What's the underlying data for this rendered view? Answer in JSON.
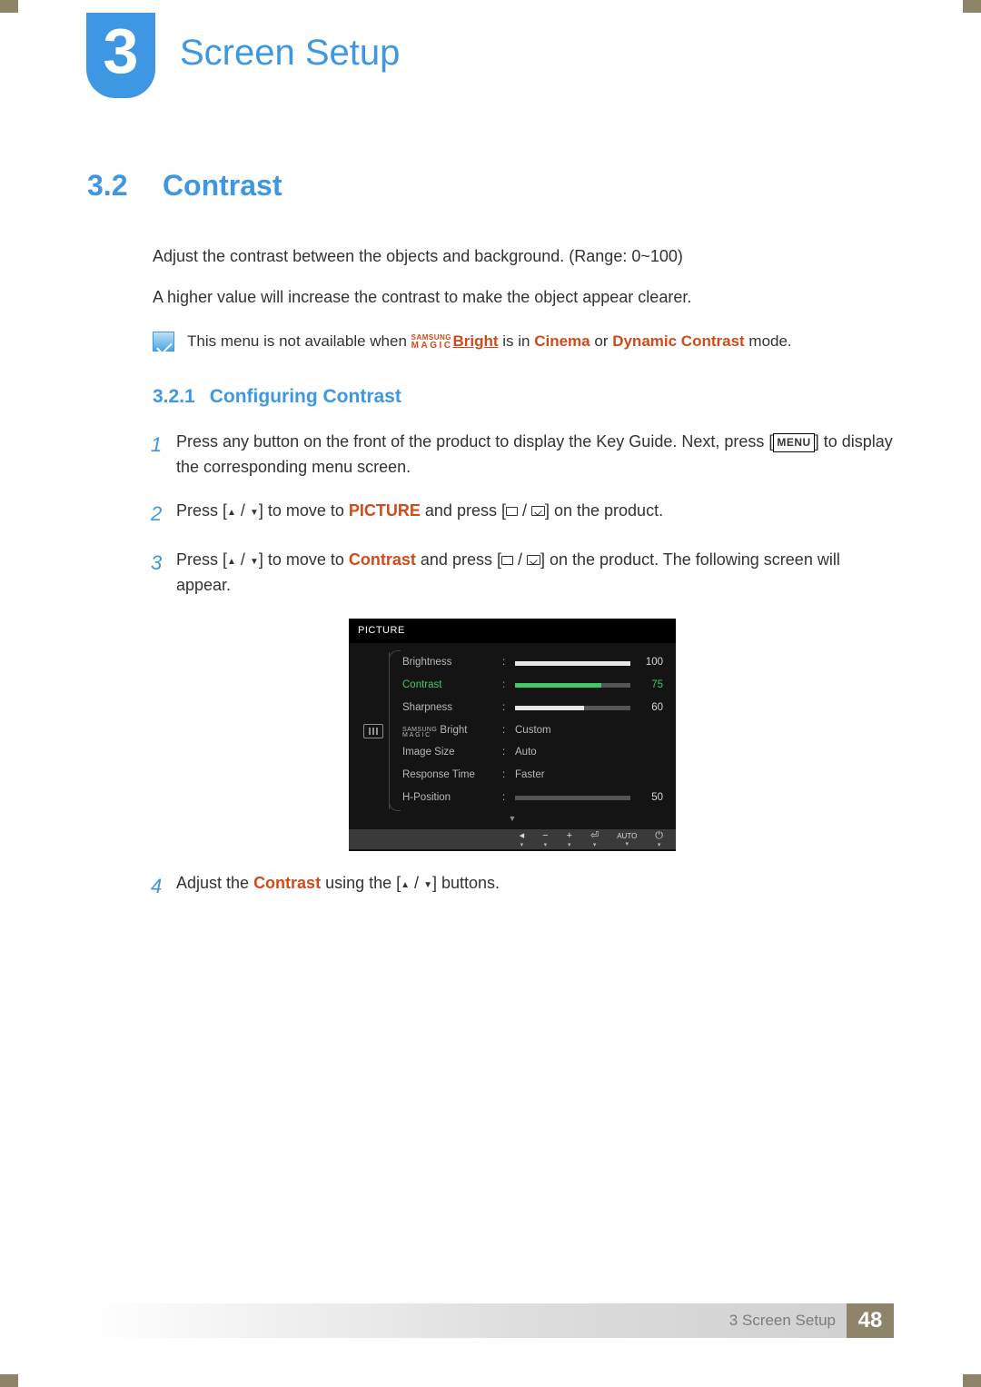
{
  "chapter": {
    "number": "3",
    "title": "Screen Setup"
  },
  "section": {
    "number": "3.2",
    "title": "Contrast"
  },
  "intro": {
    "p1": "Adjust the contrast between the objects and background. (Range: 0~100)",
    "p2": "A higher value will increase the contrast to make the object appear clearer."
  },
  "note": {
    "prefix": "This menu is not available when ",
    "magic_top": "SAMSUNG",
    "magic_bottom": "MAGIC",
    "magic_bright": "Bright",
    "mid": " is in ",
    "cinema": "Cinema",
    "or": " or ",
    "dyn": "Dynamic Contrast",
    "suffix": " mode."
  },
  "subsection": {
    "number": "3.2.1",
    "title": "Configuring Contrast"
  },
  "steps": {
    "s1": {
      "pre": "Press any button on the front of the product to display the Key Guide. Next, press [",
      "menu": "MENU",
      "post": "] to display the corresponding menu screen."
    },
    "s2": {
      "pre": "Press [",
      "mid": "] to move to ",
      "picture": "PICTURE",
      "mid2": " and press [",
      "post": "] on the product."
    },
    "s3": {
      "pre": "Press [",
      "mid": "] to move to ",
      "contrast": "Contrast",
      "mid2": " and press [",
      "post": "] on the product. The following screen will appear."
    },
    "s4": {
      "pre": "Adjust the ",
      "contrast": "Contrast",
      "mid": " using the [",
      "post": "] buttons."
    }
  },
  "osd": {
    "title": "PICTURE",
    "rows": [
      {
        "label": "Brightness",
        "value": 100,
        "slider": 100,
        "type": "slider"
      },
      {
        "label": "Contrast",
        "value": 75,
        "slider": 75,
        "type": "slider",
        "active": true
      },
      {
        "label": "Sharpness",
        "value": 60,
        "slider": 60,
        "type": "slider"
      },
      {
        "label": "MAGIC Bright",
        "text": "Custom",
        "type": "text",
        "magic": true
      },
      {
        "label": "Image Size",
        "text": "Auto",
        "type": "text"
      },
      {
        "label": "Response Time",
        "text": "Faster",
        "type": "text"
      },
      {
        "label": "H-Position",
        "value": 50,
        "slider": 0,
        "type": "slider"
      }
    ],
    "footer_auto": "AUTO"
  },
  "chart_data": {
    "type": "table",
    "title": "PICTURE",
    "rows": [
      {
        "setting": "Brightness",
        "value": "100"
      },
      {
        "setting": "Contrast",
        "value": "75"
      },
      {
        "setting": "Sharpness",
        "value": "60"
      },
      {
        "setting": "SAMSUNG MAGIC Bright",
        "value": "Custom"
      },
      {
        "setting": "Image Size",
        "value": "Auto"
      },
      {
        "setting": "Response Time",
        "value": "Faster"
      },
      {
        "setting": "H-Position",
        "value": "50"
      }
    ]
  },
  "footer": {
    "text": "3 Screen Setup",
    "page": "48"
  }
}
